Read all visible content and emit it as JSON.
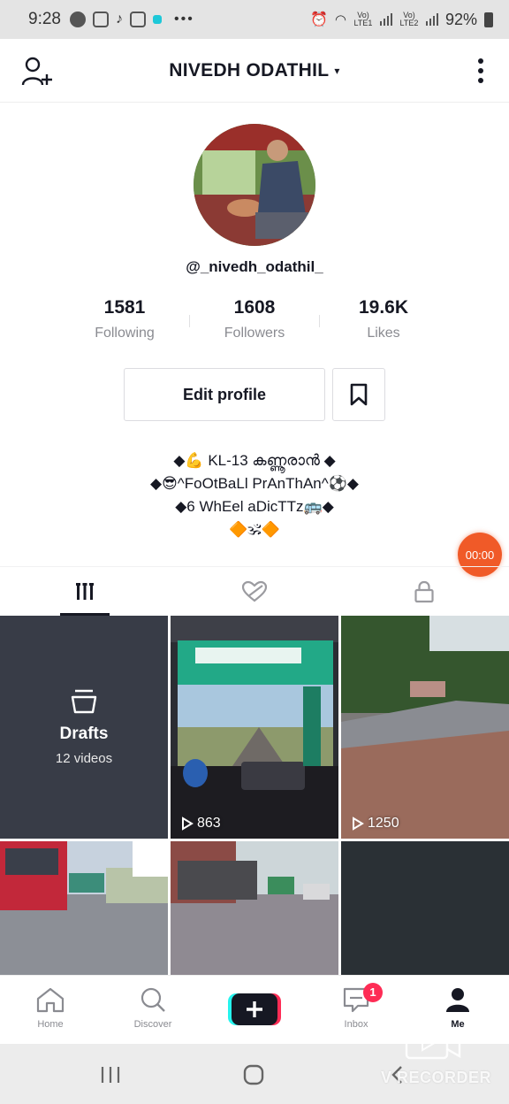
{
  "status_bar": {
    "time": "9:28",
    "sim1": "Vo) LTE1",
    "sim2": "Vo) LTE2",
    "battery": "92%"
  },
  "header": {
    "title": "NIVEDH ODATHIL",
    "caret": "▾"
  },
  "profile": {
    "handle": "@_nivedh_odathil_",
    "stats": [
      {
        "value": "1581",
        "label": "Following"
      },
      {
        "value": "1608",
        "label": "Followers"
      },
      {
        "value": "19.6K",
        "label": "Likes"
      }
    ],
    "edit_label": "Edit profile",
    "bio": [
      "◆💪 KL-13 കണ്ണൂരാൻ ◆",
      "◆😎^FoOtBaLl PrAnThAn^⚽◆",
      "◆6 WhEel aDicTTz🚌◆",
      "🔶🕉🔶"
    ]
  },
  "timer": "00:00",
  "grid": {
    "drafts_label": "Drafts",
    "drafts_count": "12 videos",
    "video_views": [
      "863",
      "1250"
    ]
  },
  "bottom_nav": {
    "items": [
      {
        "label": "Home"
      },
      {
        "label": "Discover"
      },
      {
        "label": "Inbox",
        "badge": "1"
      },
      {
        "label": "Me"
      }
    ]
  },
  "watermark": "V RECORDER",
  "colors": {
    "accent": "#fe2c55",
    "timer": "#f05a28",
    "drafts_bg": "#383c47"
  }
}
